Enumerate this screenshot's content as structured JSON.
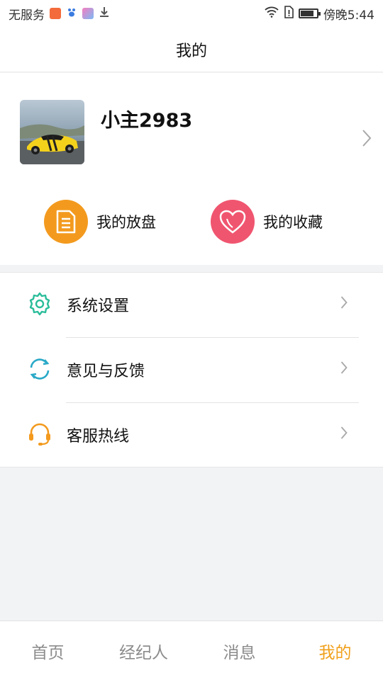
{
  "status_bar": {
    "carrier": "无服务",
    "time": "傍晚5:44",
    "battery_level_percent": 80
  },
  "header": {
    "title": "我的"
  },
  "profile": {
    "username": "小主2983"
  },
  "quick_actions": [
    {
      "label": "我的放盘",
      "icon": "document-icon",
      "color": "#f39a1e"
    },
    {
      "label": "我的收藏",
      "icon": "heart-icon",
      "color": "#f0556f"
    }
  ],
  "menu": {
    "items": [
      {
        "label": "系统设置",
        "icon": "gear-icon",
        "color": "#2bbd9a"
      },
      {
        "label": "意见与反馈",
        "icon": "refresh-icon",
        "color": "#2aa9c7"
      },
      {
        "label": "客服热线",
        "icon": "headset-icon",
        "color": "#f39a1e"
      }
    ]
  },
  "tab_bar": {
    "tabs": [
      {
        "label": "首页"
      },
      {
        "label": "经纪人"
      },
      {
        "label": "消息"
      },
      {
        "label": "我的"
      }
    ],
    "active_index": 3,
    "active_color": "#f0a01a"
  }
}
